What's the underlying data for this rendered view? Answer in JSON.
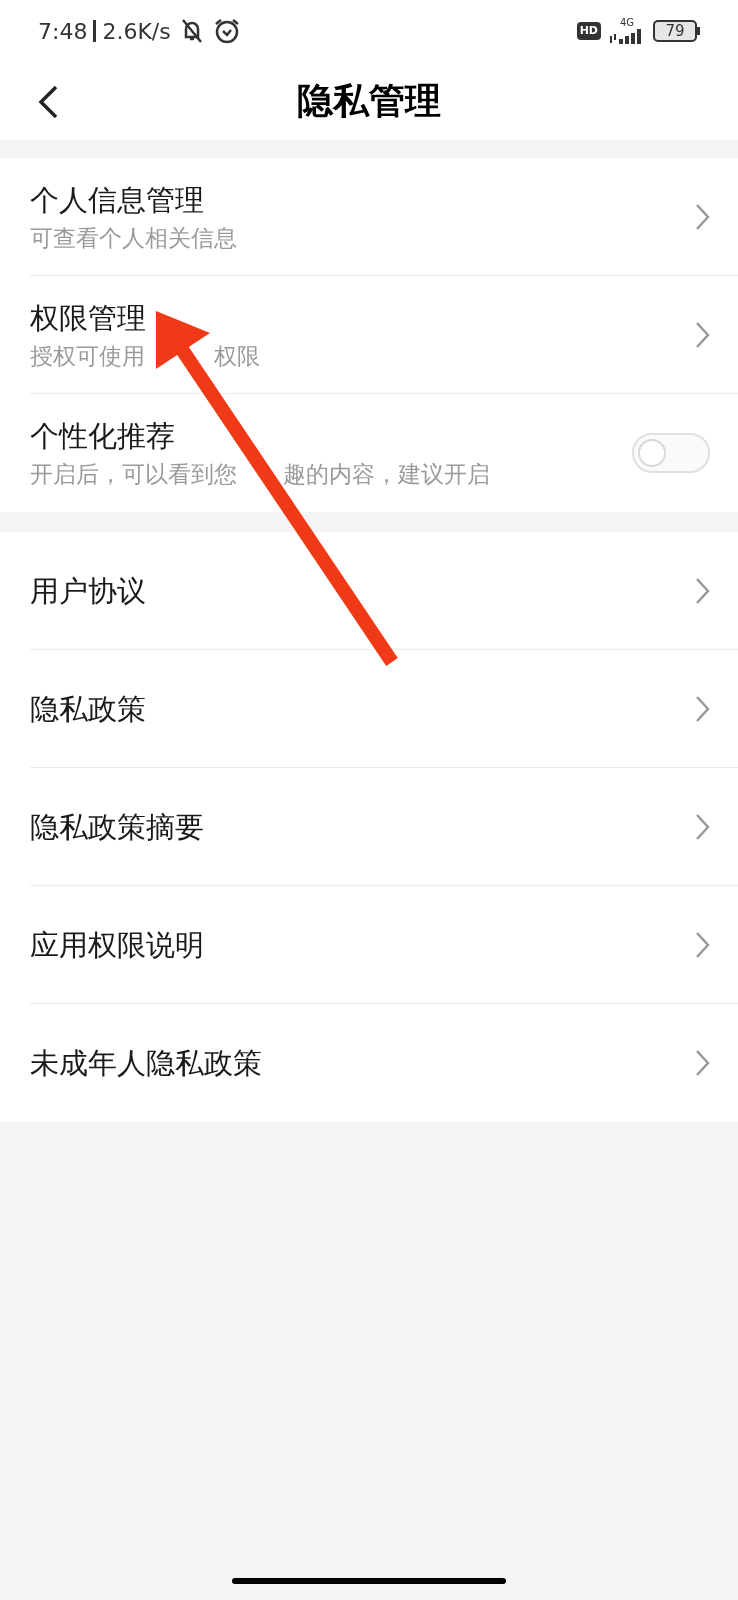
{
  "status_bar": {
    "time": "7:48",
    "speed": "2.6K/s",
    "hd": "HD",
    "network": "4G",
    "battery": "79"
  },
  "header": {
    "title": "隐私管理"
  },
  "sections": [
    {
      "items": [
        {
          "kind": "link",
          "title": "个人信息管理",
          "subtitle": [
            "可查看个人相关信息"
          ]
        },
        {
          "kind": "link",
          "title": "权限管理",
          "subtitle": [
            "授权可使用",
            "权限"
          ]
        },
        {
          "kind": "toggle",
          "title": "个性化推荐",
          "subtitle": [
            "开启后，可以看到您",
            "趣的内容，建议开启"
          ],
          "on": false
        }
      ]
    },
    {
      "items": [
        {
          "kind": "link",
          "title": "用户协议"
        },
        {
          "kind": "link",
          "title": "隐私政策"
        },
        {
          "kind": "link",
          "title": "隐私政策摘要"
        },
        {
          "kind": "link",
          "title": "应用权限说明"
        },
        {
          "kind": "link",
          "title": "未成年人隐私政策"
        }
      ]
    }
  ]
}
